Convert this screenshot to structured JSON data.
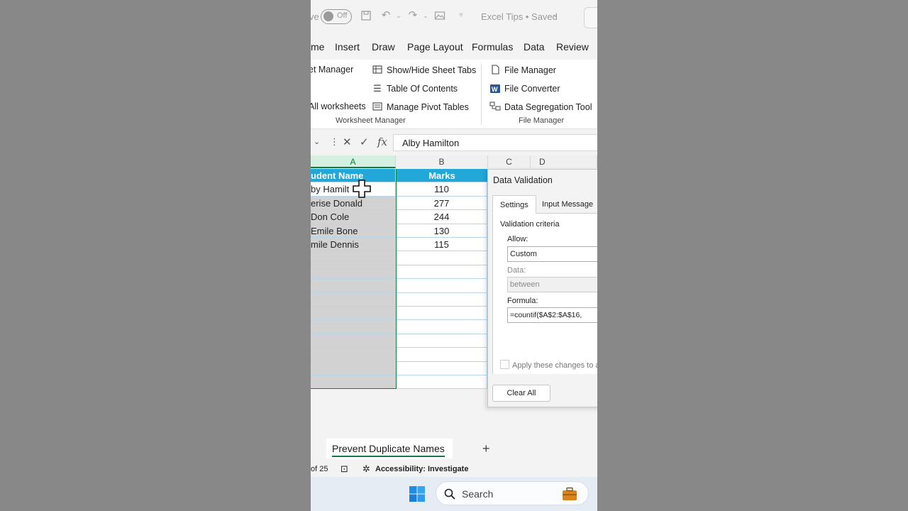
{
  "titlebar": {
    "autosave_fragment": "ve",
    "autosave_state": "Off",
    "doc_title": "Excel Tips • Saved"
  },
  "menu": [
    "me",
    "Insert",
    "Draw",
    "Page Layout",
    "Formulas",
    "Data",
    "Review"
  ],
  "ribbon": {
    "col1": [
      "et Manager",
      "All worksheets"
    ],
    "col2": [
      "Show/Hide Sheet Tabs",
      "Table Of Contents",
      "Manage Pivot Tables"
    ],
    "col3": [
      "File Manager",
      "File Converter",
      "Data Segregation Tool"
    ],
    "group1": "Worksheet Manager",
    "group2": "File Manager"
  },
  "formula_bar": {
    "fx": "fx",
    "value": "Alby Hamilton"
  },
  "columns": [
    "A",
    "B",
    "C",
    "D"
  ],
  "table": {
    "header": [
      "udent Name",
      "Marks"
    ],
    "rows": [
      [
        "by Hamilt",
        "110"
      ],
      [
        "erise Donald",
        "277"
      ],
      [
        " Don Cole",
        "244"
      ],
      [
        "Emile Bone",
        "130"
      ],
      [
        "mile Dennis",
        "115"
      ]
    ]
  },
  "dialog": {
    "title": "Data Validation",
    "tabs": [
      "Settings",
      "Input Message"
    ],
    "section": "Validation criteria",
    "allow_label": "Allow:",
    "allow_value": "Custom",
    "data_label": "Data:",
    "data_value": "between",
    "formula_label": "Formula:",
    "formula_value": "=countif($A$2:$A$16,",
    "apply_label": "Apply these changes to all",
    "clear_button": "Clear All"
  },
  "sheet": {
    "active_tab": "Prevent Duplicate Names",
    "add": "+"
  },
  "status": {
    "page": "of 25",
    "accessibility": "Accessibility: Investigate"
  },
  "taskbar": {
    "search": "Search"
  }
}
